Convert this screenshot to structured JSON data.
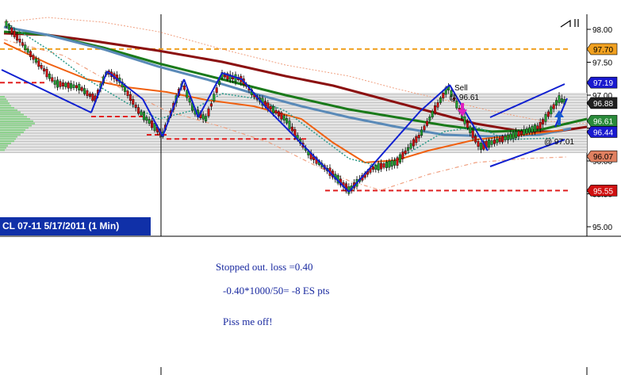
{
  "chart_title": "CL 07-11  5/17/2011 (1 Min)",
  "notes": {
    "line1": "Stopped out. loss =0.40",
    "line2": "-0.40*1000/50= -8 ES pts",
    "line3": "Piss me off!"
  },
  "annotations": {
    "sell_label": "Sell",
    "sell_price": "@ 96.61",
    "stop_price": "@ 97.01"
  },
  "price_axis": {
    "ticks": [
      "98.00",
      "97.50",
      "97.00",
      "96.50",
      "96.00",
      "95.50",
      "95.00"
    ]
  },
  "price_badges": [
    {
      "label": "97.70",
      "bg": "#f0a020",
      "fg": "#000000"
    },
    {
      "label": "97.19",
      "bg": "#1a1ad0",
      "fg": "#ffffff"
    },
    {
      "label": "96.88",
      "bg": "#202020",
      "fg": "#ffffff"
    },
    {
      "label": "96.61",
      "bg": "#2a8a3a",
      "fg": "#ffffff"
    },
    {
      "label": "96.44",
      "bg": "#1a1ad0",
      "fg": "#ffffff"
    },
    {
      "label": "96.07",
      "bg": "#e08060",
      "fg": "#000000"
    },
    {
      "label": "95.55",
      "bg": "#d01010",
      "fg": "#ffffff"
    }
  ],
  "levels": {
    "orange_dashed": 97.7,
    "red_dashed_upper": 97.19,
    "red_dashed_mid": 96.07,
    "red_dashed_low": 95.55
  },
  "colors": {
    "title_bg": "#1030a8",
    "note_text": "#1a2aa0",
    "trendline": "#1020d0",
    "ma_darkred": "#8b1010",
    "ma_green": "#1a7a1a",
    "ma_steelblue": "#5a8ab8",
    "ma_orange": "#f06010",
    "ma_teal_dotted": "#2a9a8a",
    "envelope": "#f0a080"
  }
}
